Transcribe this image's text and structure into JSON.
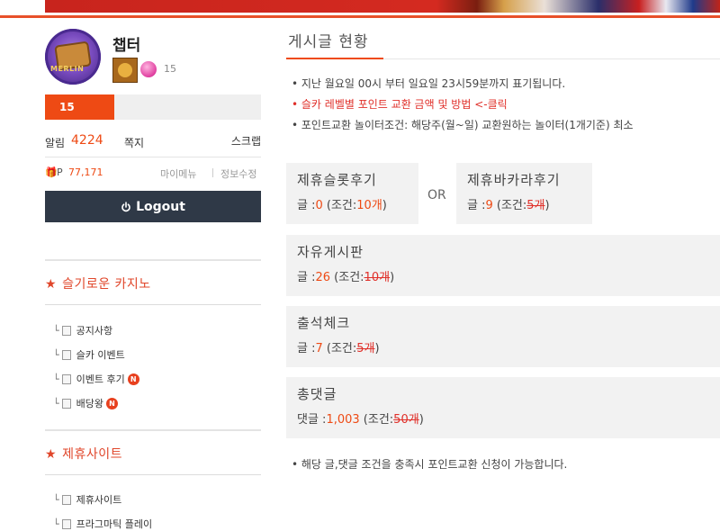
{
  "profile": {
    "avatar_text": "MERLIN",
    "username": "챕터",
    "badge_count": "15",
    "level_label": "15",
    "level_progress": 0.32
  },
  "stats": {
    "alarm_label": "알림",
    "alarm_count": "4224",
    "memo_label": "쪽지",
    "scrap_label": "스크랩",
    "point_label": "P",
    "point_value": "77,171",
    "mymenu_label": "마이메뉴",
    "edit_label": "정보수정"
  },
  "logout_label": "Logout",
  "sidebar": {
    "section1_title": "슬기로운 카지노",
    "section1_items": [
      {
        "label": "공지사항",
        "new": false
      },
      {
        "label": "슬카 이벤트",
        "new": false
      },
      {
        "label": "이벤트 후기",
        "new": true
      },
      {
        "label": "배당왕",
        "new": true
      }
    ],
    "section2_title": "제휴사이트",
    "section2_items": [
      {
        "label": "제휴사이트",
        "new": false
      },
      {
        "label": "프라그마틱 플레이",
        "new": false
      }
    ],
    "new_badge": "N"
  },
  "main": {
    "title": "게시글 현황",
    "info1": "• 지난 월요일 00시 부터 일요일 23시59분까지 표기됩니다.",
    "info2": "• 슬카 레벨별 포인트 교환 금액 및 방법 <-클릭",
    "info3": "• 포인트교환 놀이터조건: 해당주(월~일) 교환원하는 놀이터(1개기준) 최소",
    "or_label": "OR",
    "boxes": {
      "slot": {
        "title": "제휴슬롯후기",
        "prefix": "글 :",
        "count": "0",
        "cond_open": " (조건:",
        "cond": "10개",
        "cond_close": ")"
      },
      "baccarat": {
        "title": "제휴바카라후기",
        "prefix": "글 :",
        "count": "9",
        "cond_open": " (조건:",
        "cond": "5개",
        "cond_close": ")"
      },
      "free": {
        "title": "자유게시판",
        "prefix": "글 :",
        "count": "26",
        "cond_open": " (조건:",
        "cond": "10개",
        "cond_close": ")"
      },
      "attend": {
        "title": "출석체크",
        "prefix": "글 :",
        "count": "7",
        "cond_open": " (조건:",
        "cond": "5개",
        "cond_close": ")"
      },
      "comments": {
        "title": "총댓글",
        "prefix": "댓글 :",
        "count": "1,003",
        "cond_open": " (조건:",
        "cond": "50개",
        "cond_close": ")"
      }
    },
    "footer": "• 해당 글,댓글 조건을 충족시 포인트교환 신청이 가능합니다."
  },
  "colors": {
    "accent": "#ee4a14",
    "red_text": "#e0302a",
    "logout_bg": "#2f3947",
    "box_bg": "#f2f2f2"
  }
}
